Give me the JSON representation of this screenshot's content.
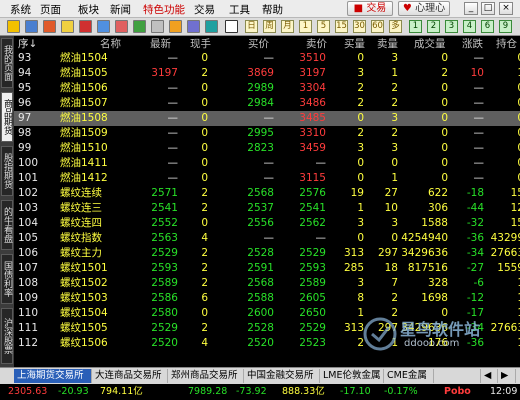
{
  "menu": {
    "items": [
      "系统",
      "页面",
      "板块",
      "新闻",
      "特色功能",
      "交易",
      "工具",
      "帮助"
    ],
    "trade_label": "交易",
    "xl_label": "心理心"
  },
  "toolbar": {
    "num_buttons": [
      "日",
      "周",
      "月",
      "1",
      "5",
      "15",
      "30",
      "60",
      "多"
    ]
  },
  "side_tabs": [
    "我的页面",
    "商品期货",
    "股指期货",
    "的牛看盘",
    "国债利率",
    "沪深股票"
  ],
  "headers": [
    "序↓",
    "名称",
    "最新",
    "现手",
    "买价",
    "卖价",
    "买量",
    "卖量",
    "成交量",
    "涨跌",
    "持仓"
  ],
  "rows": [
    {
      "no": "93",
      "name": "燃油1504",
      "last": "—",
      "vol": "0",
      "bid": "—",
      "ask": "3510",
      "bidq": "0",
      "askq": "3",
      "turnover": "0",
      "chg": "—",
      "oi": "0"
    },
    {
      "no": "94",
      "name": "燃油1505",
      "last": "3197",
      "vol": "2",
      "bid": "3869",
      "ask": "3197",
      "bidq": "3",
      "askq": "1",
      "turnover": "2",
      "chg": "10",
      "oi": "1"
    },
    {
      "no": "95",
      "name": "燃油1506",
      "last": "—",
      "vol": "0",
      "bid": "2989",
      "ask": "3304",
      "bidq": "2",
      "askq": "2",
      "turnover": "0",
      "chg": "—",
      "oi": "0"
    },
    {
      "no": "96",
      "name": "燃油1507",
      "last": "—",
      "vol": "0",
      "bid": "2984",
      "ask": "3486",
      "bidq": "2",
      "askq": "2",
      "turnover": "0",
      "chg": "—",
      "oi": "0"
    },
    {
      "no": "97",
      "name": "燃油1508",
      "last": "—",
      "vol": "0",
      "bid": "—",
      "ask": "3485",
      "bidq": "0",
      "askq": "3",
      "turnover": "0",
      "chg": "—",
      "oi": "0"
    },
    {
      "no": "98",
      "name": "燃油1509",
      "last": "—",
      "vol": "0",
      "bid": "2995",
      "ask": "3310",
      "bidq": "2",
      "askq": "2",
      "turnover": "0",
      "chg": "—",
      "oi": "0"
    },
    {
      "no": "99",
      "name": "燃油1510",
      "last": "—",
      "vol": "0",
      "bid": "2823",
      "ask": "3459",
      "bidq": "3",
      "askq": "3",
      "turnover": "0",
      "chg": "—",
      "oi": "0"
    },
    {
      "no": "100",
      "name": "燃油1411",
      "last": "—",
      "vol": "0",
      "bid": "—",
      "ask": "—",
      "bidq": "0",
      "askq": "0",
      "turnover": "0",
      "chg": "—",
      "oi": "0"
    },
    {
      "no": "101",
      "name": "燃油1412",
      "last": "—",
      "vol": "0",
      "bid": "—",
      "ask": "3115",
      "bidq": "0",
      "askq": "1",
      "turnover": "0",
      "chg": "—",
      "oi": "0"
    },
    {
      "no": "102",
      "name": "螺纹连续",
      "last": "2571",
      "vol": "2",
      "bid": "2568",
      "ask": "2576",
      "bidq": "19",
      "askq": "27",
      "turnover": "622",
      "chg": "-18",
      "oi": "15"
    },
    {
      "no": "103",
      "name": "螺纹连三",
      "last": "2541",
      "vol": "2",
      "bid": "2537",
      "ask": "2541",
      "bidq": "1",
      "askq": "10",
      "turnover": "306",
      "chg": "-44",
      "oi": "12"
    },
    {
      "no": "104",
      "name": "螺纹连四",
      "last": "2552",
      "vol": "0",
      "bid": "2556",
      "ask": "2562",
      "bidq": "3",
      "askq": "3",
      "turnover": "1588",
      "chg": "-32",
      "oi": "15"
    },
    {
      "no": "105",
      "name": "螺纹指数",
      "last": "2563",
      "vol": "4",
      "bid": "—",
      "ask": "—",
      "bidq": "0",
      "askq": "0",
      "turnover": "4254940",
      "chg": "-36",
      "oi": "43299"
    },
    {
      "no": "106",
      "name": "螺纹主力",
      "last": "2529",
      "vol": "2",
      "bid": "2528",
      "ask": "2529",
      "bidq": "313",
      "askq": "297",
      "turnover": "3429636",
      "chg": "-34",
      "oi": "27663"
    },
    {
      "no": "107",
      "name": "螺纹1501",
      "last": "2593",
      "vol": "2",
      "bid": "2591",
      "ask": "2593",
      "bidq": "285",
      "askq": "18",
      "turnover": "817516",
      "chg": "-27",
      "oi": "1559"
    },
    {
      "no": "108",
      "name": "螺纹1502",
      "last": "2589",
      "vol": "2",
      "bid": "2568",
      "ask": "2589",
      "bidq": "3",
      "askq": "7",
      "turnover": "328",
      "chg": "-6",
      "oi": "1"
    },
    {
      "no": "109",
      "name": "螺纹1503",
      "last": "2586",
      "vol": "6",
      "bid": "2588",
      "ask": "2605",
      "bidq": "8",
      "askq": "2",
      "turnover": "1698",
      "chg": "-12",
      "oi": "1"
    },
    {
      "no": "110",
      "name": "螺纹1504",
      "last": "2580",
      "vol": "0",
      "bid": "2600",
      "ask": "2650",
      "bidq": "1",
      "askq": "2",
      "turnover": "0",
      "chg": "-17",
      "oi": "1"
    },
    {
      "no": "111",
      "name": "螺纹1505",
      "last": "2529",
      "vol": "2",
      "bid": "2528",
      "ask": "2529",
      "bidq": "313",
      "askq": "297",
      "turnover": "3429636",
      "chg": "-34",
      "oi": "27663"
    },
    {
      "no": "112",
      "name": "螺纹1506",
      "last": "2520",
      "vol": "4",
      "bid": "2520",
      "ask": "2523",
      "bidq": "2",
      "askq": "1",
      "turnover": "176",
      "chg": "-36",
      "oi": "1"
    }
  ],
  "bottom_tabs": [
    "上海期货交易所",
    "大连商品交易所",
    "郑州商品交易所",
    "中国金融交易所",
    "LME伦敦金属",
    "CME金属"
  ],
  "status": {
    "a": "2305.63",
    "b": "-20.93",
    "c": "794.11亿",
    "d": "7989.28",
    "e": "-73.92",
    "f": "888.33亿",
    "g": "-17.10",
    "h": "-0.17%",
    "brand": "Pobo",
    "time": "12:09"
  },
  "watermark": {
    "text": "星鸟软件站",
    "url": "ddooo.com"
  }
}
